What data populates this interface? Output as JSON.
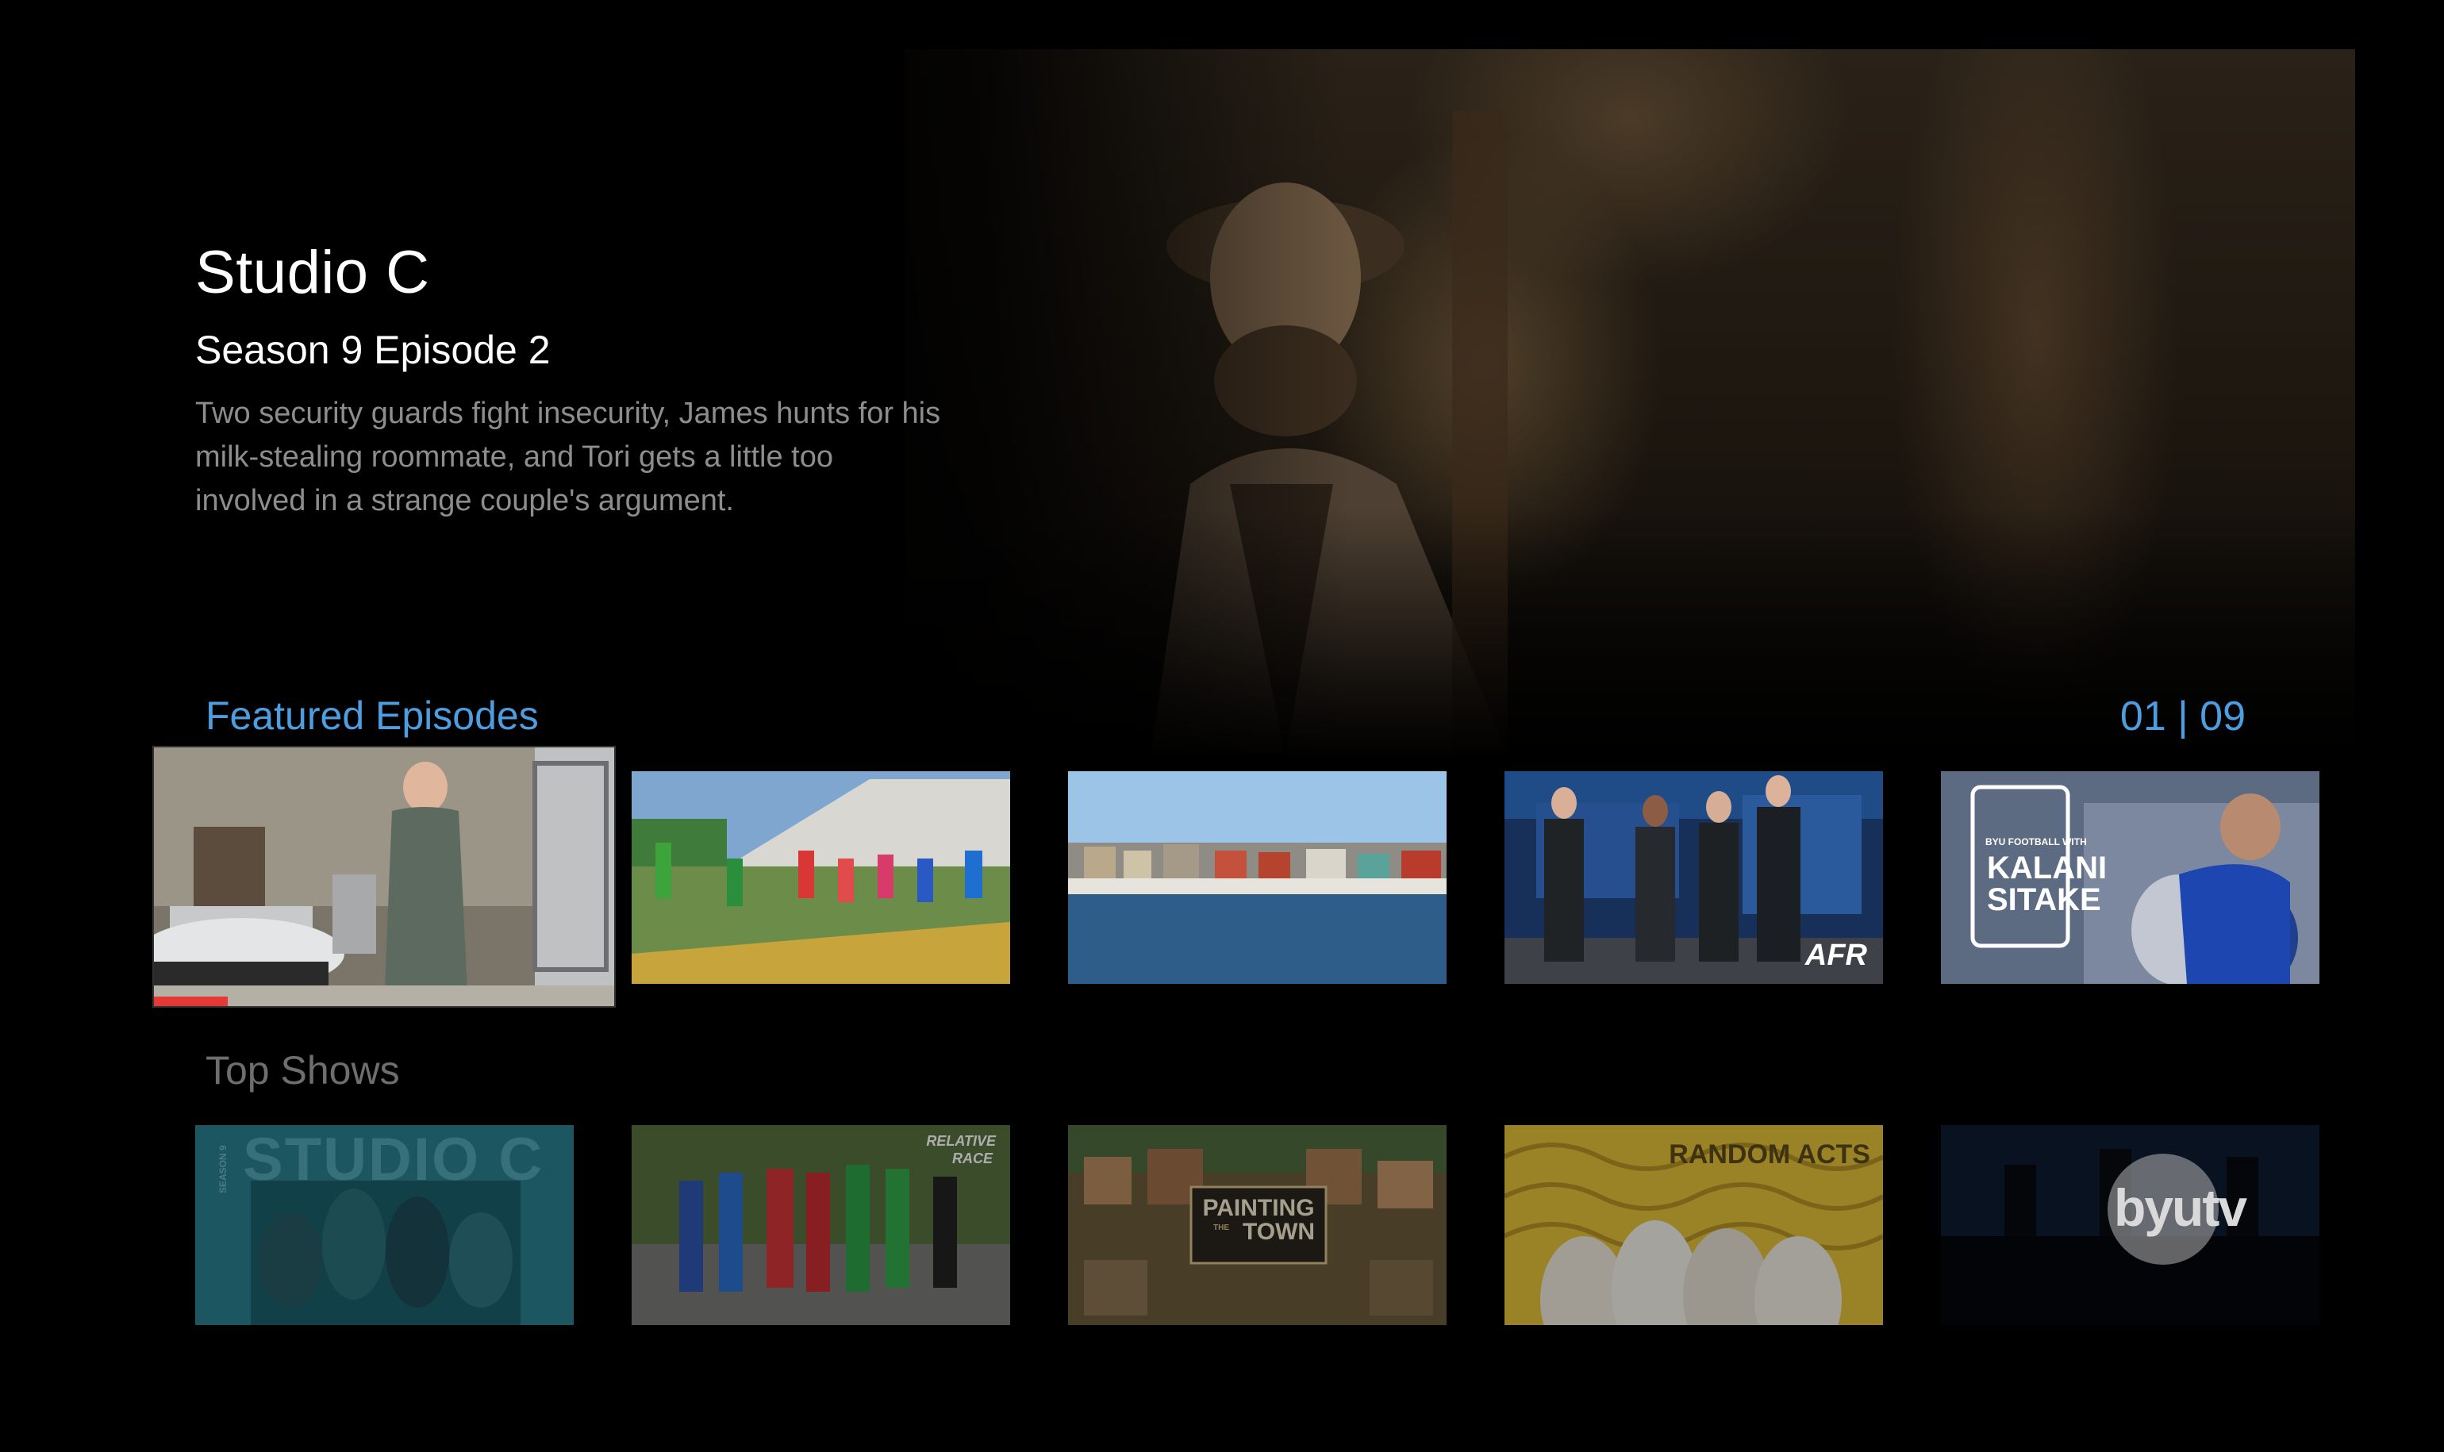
{
  "hero": {
    "show_title": "Studio C",
    "episode_label": "Season 9 Episode 2",
    "description": "Two security guards fight insecurity, James hunts for his milk-stealing roommate, and Tori gets a little too involved in a strange couple's argument."
  },
  "featured": {
    "heading": "Featured Episodes",
    "counter": "01 | 09",
    "progress_fraction": 0.16,
    "tiles": [
      {
        "name": "featured-episode-garage"
      },
      {
        "name": "featured-episode-race"
      },
      {
        "name": "featured-episode-harbor"
      },
      {
        "name": "featured-episode-afr",
        "badge": "AFR"
      },
      {
        "name": "featured-episode-kalani",
        "badge_line1": "BYU FOOTBALL WITH",
        "badge_line2": "KALANI",
        "badge_line3": "SITAKE"
      }
    ]
  },
  "top_shows": {
    "heading": "Top Shows",
    "tiles": [
      {
        "name": "top-show-studio-c",
        "title_art": "STUDIO C",
        "season_art": "SEASON 9"
      },
      {
        "name": "top-show-relative-race",
        "title_art_line1": "RELATIVE",
        "title_art_line2": "RACE"
      },
      {
        "name": "top-show-painting-the-town",
        "title_art_line1": "PAINTING",
        "title_art_line2": "THE",
        "title_art_line3": "TOWN"
      },
      {
        "name": "top-show-random-acts",
        "title_art": "RANDOM ACTS"
      },
      {
        "name": "top-show-byutv",
        "logo": "byutv"
      }
    ]
  },
  "colors": {
    "accent_blue": "#4d9ee0",
    "progress_red": "#e53935",
    "description_gray": "#8d8d8d",
    "section_gray": "#6e6e6e"
  }
}
